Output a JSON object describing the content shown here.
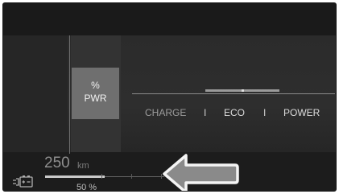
{
  "power_mode": {
    "label_top": "%",
    "label_bottom": "PWR",
    "modes": [
      "CHARGE",
      "ECO",
      "POWER"
    ],
    "separator": "I",
    "active_mode": "ECO"
  },
  "range": {
    "value": "250",
    "unit": "km"
  },
  "battery": {
    "percent_label": "50 %",
    "level_fraction": 0.5,
    "icon": "battery-plug-icon"
  },
  "callout": {
    "icon": "left-arrow-icon"
  },
  "colors": {
    "background": "#2b2b2b",
    "pwr_box": "#6f6f6f",
    "text": "#dcdcdc",
    "arrow_fill": "#8a8a8a"
  }
}
